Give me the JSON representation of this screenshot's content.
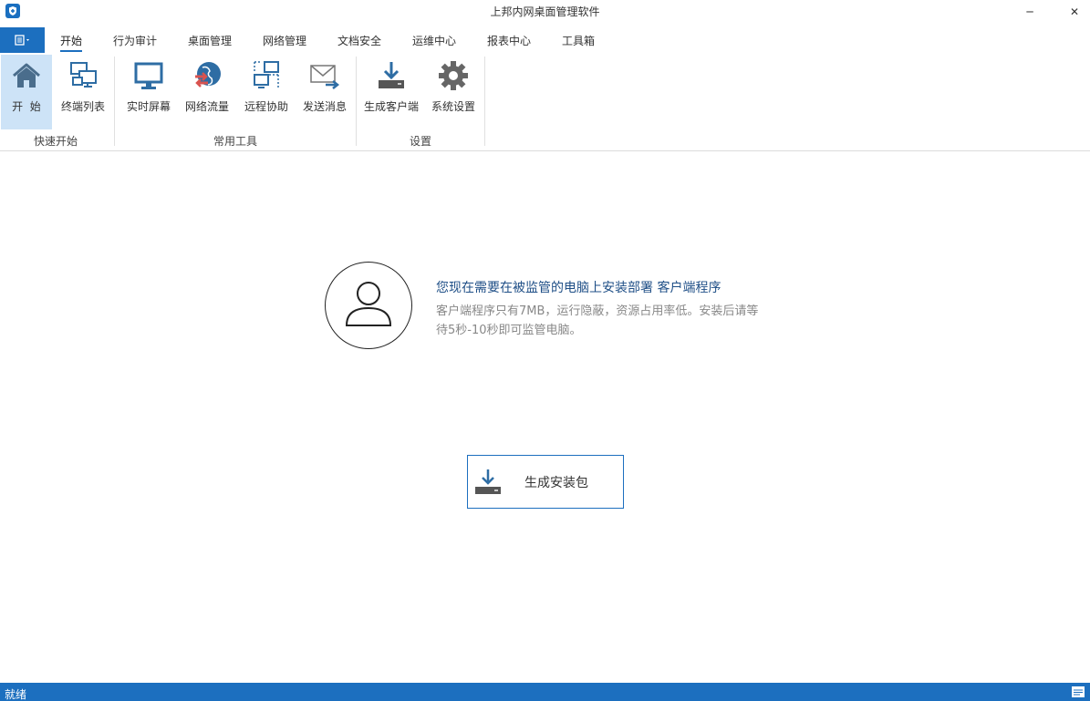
{
  "window": {
    "title": "上邦内网桌面管理软件",
    "minimize_glyph": "─",
    "close_glyph": "✕"
  },
  "tabs": [
    {
      "label": "开始",
      "active": true
    },
    {
      "label": "行为审计"
    },
    {
      "label": "桌面管理"
    },
    {
      "label": "网络管理"
    },
    {
      "label": "文档安全"
    },
    {
      "label": "运维中心"
    },
    {
      "label": "报表中心"
    },
    {
      "label": "工具箱"
    }
  ],
  "ribbon": {
    "groups": [
      {
        "label": "快速开始",
        "buttons": [
          {
            "label": "开  始",
            "icon": "home-icon",
            "selected": true
          },
          {
            "label": "终端列表",
            "icon": "terminal-list-icon"
          }
        ]
      },
      {
        "label": "常用工具",
        "buttons": [
          {
            "label": "实时屏幕",
            "icon": "monitor-icon"
          },
          {
            "label": "网络流量",
            "icon": "network-traffic-icon"
          },
          {
            "label": "远程协助",
            "icon": "remote-assist-icon"
          },
          {
            "label": "发送消息",
            "icon": "send-message-icon"
          }
        ]
      },
      {
        "label": "设置",
        "buttons": [
          {
            "label": "生成客户端",
            "icon": "download-icon"
          },
          {
            "label": "系统设置",
            "icon": "gear-icon"
          }
        ]
      }
    ]
  },
  "main": {
    "heading": "您现在需要在被监管的电脑上安装部署 客户端程序",
    "description": "客户端程序只有7MB，运行隐蔽，资源占用率低。安装后请等待5秒-10秒即可监管电脑。",
    "generate_button": "生成安装包"
  },
  "status": {
    "text": "就绪"
  },
  "colors": {
    "accent": "#1c6fbf",
    "heading": "#1f4f87",
    "selected": "#cde3f7"
  }
}
